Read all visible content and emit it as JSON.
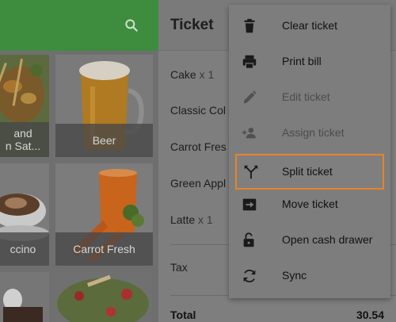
{
  "header": {
    "title": "Ticket"
  },
  "products": [
    {
      "label": "and\nn Sat..."
    },
    {
      "label": "Beer"
    },
    {
      "label": "ccino"
    },
    {
      "label": "Carrot Fresh"
    }
  ],
  "ticket": {
    "items": [
      {
        "name": "Cake",
        "qty": "x 1"
      },
      {
        "name": "Classic Col",
        "qty": ""
      },
      {
        "name": "Carrot Fres",
        "qty": ""
      },
      {
        "name": "Green Appl",
        "qty": ""
      },
      {
        "name": "Latte",
        "qty": "x 1"
      }
    ],
    "tax_label": "Tax",
    "total_label": "Total",
    "total_value": "30.54"
  },
  "menu": {
    "items": [
      {
        "label": "Clear ticket",
        "icon": "trash-icon",
        "disabled": false
      },
      {
        "label": "Print bill",
        "icon": "printer-icon",
        "disabled": false
      },
      {
        "label": "Edit ticket",
        "icon": "pencil-icon",
        "disabled": true
      },
      {
        "label": "Assign ticket",
        "icon": "assign-person-icon",
        "disabled": true
      },
      {
        "label": "Split ticket",
        "icon": "split-icon",
        "disabled": false
      },
      {
        "label": "Move ticket",
        "icon": "move-arrow-icon",
        "disabled": false
      },
      {
        "label": "Open cash drawer",
        "icon": "unlock-icon",
        "disabled": false
      },
      {
        "label": "Sync",
        "icon": "sync-icon",
        "disabled": false
      }
    ]
  },
  "colors": {
    "toolbar_green": "#3e8c3e",
    "highlight_orange": "#e8832a"
  }
}
